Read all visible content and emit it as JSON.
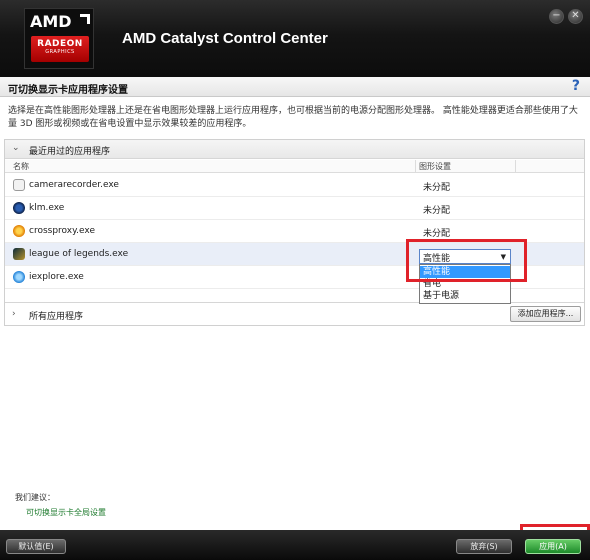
{
  "header": {
    "logo_brand": "AMD",
    "logo_badge_line1": "RADEON",
    "logo_badge_line2": "GRAPHICS",
    "app_title": "AMD Catalyst Control Center",
    "minimize_symbol": "−",
    "close_symbol": "✕"
  },
  "page": {
    "title": "可切换显示卡应用程序设置",
    "help_symbol": "?",
    "description": "选择是在高性能图形处理器上还是在省电图形处理器上运行应用程序，也可根据当前的电源分配图形处理器。 高性能处理器更适合那些使用了大量 3D 图形或视频或在省电设置中显示效果较差的应用程序。"
  },
  "recent_section": {
    "title": "最近用过的应用程序",
    "col_name": "名称",
    "col_setting": "图形设置",
    "rows": [
      {
        "name": "camerarecorder.exe",
        "value": "未分配",
        "icon": "camera-icon"
      },
      {
        "name": "klm.exe",
        "value": "未分配",
        "icon": "klm-icon"
      },
      {
        "name": "crossproxy.exe",
        "value": "未分配",
        "icon": "crossproxy-icon"
      },
      {
        "name": "league of legends.exe",
        "value": "",
        "icon": "lol-icon"
      },
      {
        "name": "iexplore.exe",
        "value": "",
        "icon": "ie-icon"
      }
    ]
  },
  "dropdown": {
    "selected": "高性能",
    "options": [
      "高性能",
      "省电",
      "基于电源"
    ]
  },
  "all_section": {
    "title": "所有应用程序",
    "add_button": "添加应用程序..."
  },
  "footer": {
    "suggestion_label": "我们建议：",
    "suggestion_link": "可切换显示卡全局设置",
    "defaults_button": "默认值(E)",
    "discard_button": "放弃(S)",
    "apply_button": "应用(A)"
  },
  "colors": {
    "highlight_red": "#e0222a",
    "accent_blue": "#3399ff",
    "apply_green": "#1d8a2a"
  }
}
